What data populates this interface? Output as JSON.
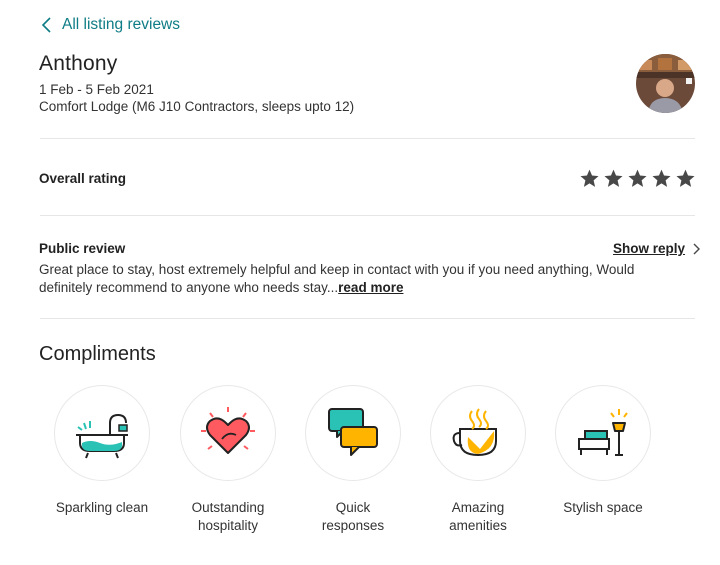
{
  "nav": {
    "back_label": "All listing reviews"
  },
  "reviewer": {
    "name": "Anthony",
    "dates": "1 Feb - 5 Feb 2021",
    "listing": "Comfort Lodge (M6 J10 Contractors, sleeps upto 12)"
  },
  "rating": {
    "label": "Overall rating",
    "stars": 5,
    "star_color": "#484848"
  },
  "review": {
    "label": "Public review",
    "show_reply": "Show reply",
    "text": "Great place to stay, host extremely helpful and keep in contact with you if you need anything, Would definitely recommend to anyone who needs stay...",
    "read_more": "read more"
  },
  "compliments": {
    "title": "Compliments",
    "items": [
      {
        "icon": "bathtub-icon",
        "label_line1": "Sparkling clean",
        "label_line2": ""
      },
      {
        "icon": "heart-icon",
        "label_line1": "Outstanding",
        "label_line2": "hospitality"
      },
      {
        "icon": "chat-bubbles-icon",
        "label_line1": "Quick",
        "label_line2": "responses"
      },
      {
        "icon": "coffee-cup-icon",
        "label_line1": "Amazing",
        "label_line2": "amenities"
      },
      {
        "icon": "armchair-lamp-icon",
        "label_line1": "Stylish space",
        "label_line2": ""
      }
    ]
  },
  "colors": {
    "link": "#0e7c86",
    "teal": "#29c2b4",
    "red": "#ff5a5f",
    "yellow": "#ffb400"
  }
}
